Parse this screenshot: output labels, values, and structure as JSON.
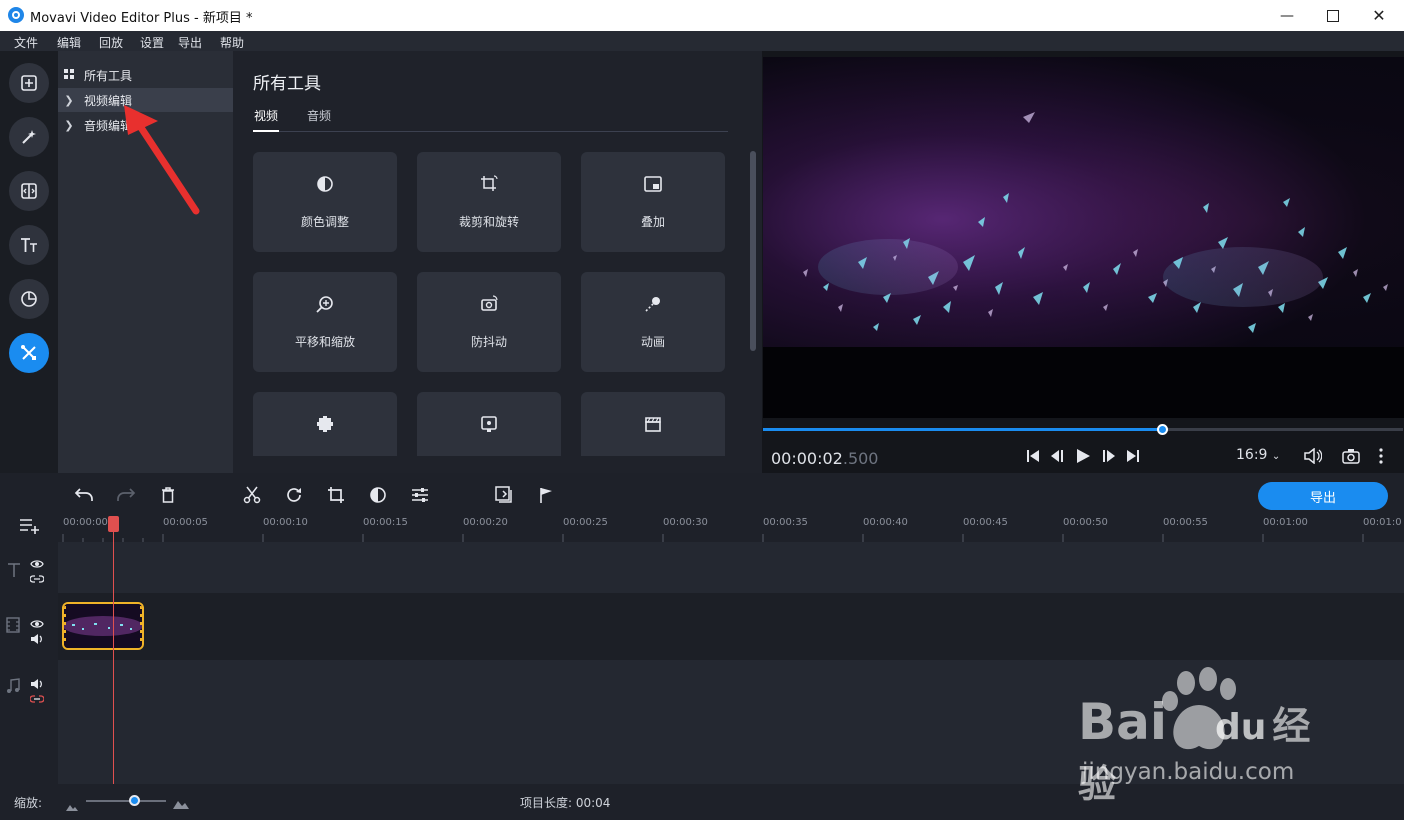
{
  "window": {
    "title": "Movavi Video Editor Plus - 新项目 *",
    "controls": [
      "minimize",
      "maximize",
      "close"
    ]
  },
  "menu": [
    "文件",
    "编辑",
    "回放",
    "设置",
    "导出",
    "帮助"
  ],
  "rail": {
    "items": [
      "import-icon",
      "magic-wand-icon",
      "transitions-icon",
      "titles-icon",
      "stickers-icon",
      "tools-icon"
    ],
    "active": "tools-icon"
  },
  "tree": {
    "items": [
      {
        "label": "所有工具",
        "icon": "grid-icon",
        "selected": false
      },
      {
        "label": "视频编辑",
        "icon": "chevron-right-icon",
        "selected": true
      },
      {
        "label": "音频编辑",
        "icon": "chevron-right-icon",
        "selected": false
      }
    ]
  },
  "tools": {
    "title": "所有工具",
    "tabs": [
      {
        "label": "视频",
        "active": true
      },
      {
        "label": "音频",
        "active": false
      }
    ],
    "tiles": [
      {
        "label": "颜色调整",
        "icon": "color-adjust-icon"
      },
      {
        "label": "裁剪和旋转",
        "icon": "crop-rotate-icon"
      },
      {
        "label": "叠加",
        "icon": "overlay-icon"
      },
      {
        "label": "平移和缩放",
        "icon": "pan-zoom-icon"
      },
      {
        "label": "防抖动",
        "icon": "stabilize-icon"
      },
      {
        "label": "动画",
        "icon": "animation-icon"
      },
      {
        "label": "",
        "icon": "blur-icon"
      },
      {
        "label": "",
        "icon": "highlight-icon"
      },
      {
        "label": "",
        "icon": "clapper-icon"
      }
    ]
  },
  "preview": {
    "timecode": "00:00:02",
    "timecode_ms": ".500",
    "progress": 0.623,
    "aspect_ratio": "16:9"
  },
  "timeline": {
    "export_label": "导出",
    "ruler": [
      "00:00:00",
      "00:00:05",
      "00:00:10",
      "00:00:15",
      "00:00:20",
      "00:00:25",
      "00:00:30",
      "00:00:35",
      "00:00:40",
      "00:00:45",
      "00:00:50",
      "00:00:55",
      "00:01:00",
      "00:01:0"
    ],
    "toolbar_icons": [
      "undo-icon",
      "redo-icon",
      "delete-icon",
      "cut-icon",
      "rotate-icon",
      "crop-icon",
      "color-icon",
      "adjust-icon",
      "export-frame-icon",
      "marker-icon"
    ]
  },
  "status": {
    "zoom_label": "缩放:",
    "project_length": "项目长度: 00:04"
  },
  "colors": {
    "accent": "#1a8cf0",
    "clip_border": "#f0b328",
    "playhead": "#e0504f",
    "annotation": "#e8302e"
  },
  "watermark": {
    "brand": "Bai",
    "brand2": "du",
    "brand_cn": "经验",
    "url": "jingyan.baidu.com"
  }
}
